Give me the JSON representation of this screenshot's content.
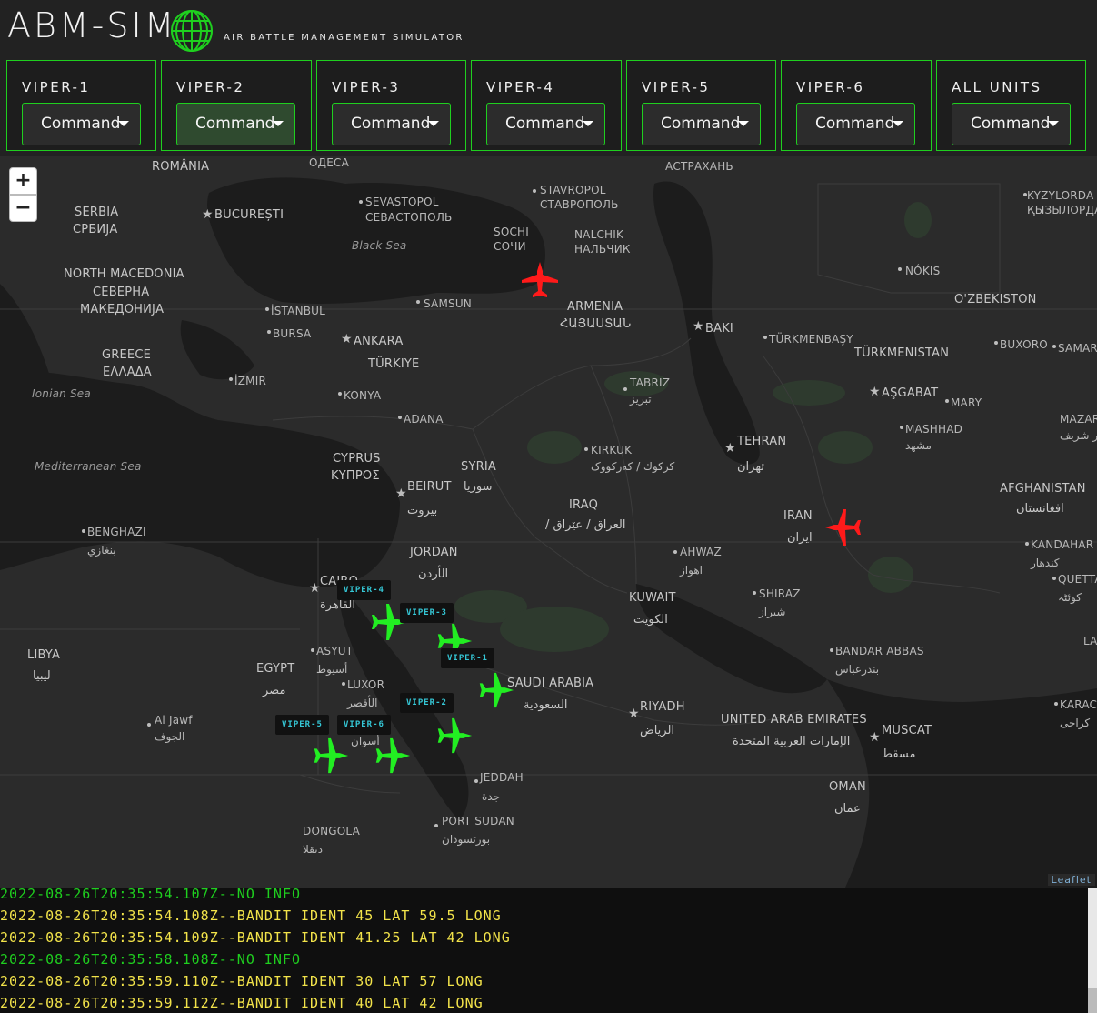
{
  "header": {
    "title": "ABM-SIM",
    "subtitle": "AIR BATTLE MANAGEMENT SIMULATOR"
  },
  "units": [
    {
      "name": "VIPER-1",
      "command_label": "Command"
    },
    {
      "name": "VIPER-2",
      "command_label": "Command"
    },
    {
      "name": "VIPER-3",
      "command_label": "Command"
    },
    {
      "name": "VIPER-4",
      "command_label": "Command"
    },
    {
      "name": "VIPER-5",
      "command_label": "Command"
    },
    {
      "name": "VIPER-6",
      "command_label": "Command"
    },
    {
      "name": "ALL UNITS",
      "command_label": "Command"
    }
  ],
  "map": {
    "zoom_in": "+",
    "zoom_out": "−",
    "attribution": "Leaflet",
    "labels": {
      "romania": "ROMÂNIA",
      "odesa": "ОДЕСА",
      "astrakhan": "АСТРАХАНЬ",
      "kyzylorda": "KYZYLORDA",
      "kyzylorda_local": "ҚЫЗЫЛОРДА",
      "serbia": "SERBIA",
      "serbia_local": "СРБИЈА",
      "bucuresti": "BUCUREȘTI",
      "sevastopol": "SEVASTOPOL",
      "sevastopol_local": "СЕВАСТОПОЛЬ",
      "stavropol": "STAVROPOL",
      "stavropol_local": "СТАВРОПОЛЬ",
      "sochi": "SOCHI",
      "sochi_local": "СОЧИ",
      "nalchik": "NALCHIK",
      "nalchik_local": "НАЛЬЧИК",
      "black_sea": "Black Sea",
      "nokis": "NÓKIS",
      "n_macedonia": "NORTH MACEDONIA",
      "n_macedonia_l1": "СЕВЕРНА",
      "n_macedonia_l2": "МАКЕДОНИЈА",
      "samsun": "SAMSUN",
      "armenia": "ARMENIA",
      "armenia_local": "ՀԱՅԱՍՏԱՆ",
      "uzbekistan": "O'ZBEKISTON",
      "istanbul": "İSTANBUL",
      "baki": "BAKI",
      "bursa": "BURSA",
      "ankara": "ANKARA",
      "turkmenbasy": "TÜRKMENBAŞY",
      "buxoro": "BUXORO",
      "samarqand": "SAMARQ",
      "greece": "GREECE",
      "greece_local": "ΕΛΛΑΔΑ",
      "turkiye": "TÜRKIYE",
      "turkmenistan": "TÜRKMENISTAN",
      "izmir": "İZMIR",
      "tabriz": "TABRIZ",
      "tabriz_local": "تبریز",
      "ionian": "Ionian Sea",
      "konya": "KONYA",
      "asgabat": "AŞGABAT",
      "mary": "MARY",
      "adana": "ADANA",
      "mashhad": "MASHHAD",
      "mashhad_local": "مشهد",
      "mazar": "MAZAR",
      "mazar_local": "مزار شریف",
      "kirkuk": "KIRKUK",
      "kirkuk_local": "كركوك / کەرکووک",
      "tehran": "TEHRAN",
      "tehran_local": "تهران",
      "cyprus": "CYPRUS",
      "cyprus_local": "ΚΥΠΡΟΣ",
      "syria": "SYRIA",
      "syria_local": "سوريا",
      "med_sea": "Mediterranean Sea",
      "afghanistan": "AFGHANISTAN",
      "afghanistan_local": "افغانستان",
      "beirut": "BEIRUT",
      "beirut_local": "بيروت",
      "iraq": "IRAQ",
      "iraq_local": "/ العراق / عێراق",
      "iran": "IRAN",
      "iran_local": "ایران",
      "benghazi": "BENGHAZI",
      "benghazi_local": "بنغازي",
      "jordan": "JORDAN",
      "jordan_local": "الأردن",
      "ahwaz": "AHWAZ",
      "ahwaz_local": "اهواز",
      "kandahar": "KANDAHAR",
      "kandahar_local": "کندهار",
      "cairo": "CAIRO",
      "cairo_local": "القاهرة",
      "quetta": "QUETTA",
      "quetta_local": "کوئٹہ",
      "kuwait": "KUWAIT",
      "kuwait_local": "الكويت",
      "shiraz": "SHIRAZ",
      "shiraz_local": "شيراز",
      "libya": "LIBYA",
      "libya_local": "ليبيا",
      "asyut": "ASYUT",
      "asyut_local": "أسيوط",
      "bandar_abbas": "BANDAR ABBAS",
      "bandar_abbas_local": "بندرعباس",
      "lah": "LAH",
      "egypt": "EGYPT",
      "egypt_local": "مصر",
      "luxor": "LUXOR",
      "luxor_local": "الأقصر",
      "saudi": "SAUDI ARABIA",
      "saudi_local": "السعودية",
      "karachi": "KARACH",
      "karachi_local": "کراچی",
      "riyadh": "RIYADH",
      "riyadh_local": "الرياض",
      "aljawf": "Al Jawf",
      "aljawf_local": "الجوف",
      "uae": "UNITED ARAB EMIRATES",
      "uae_local": "الإمارات العربية المتحدة",
      "muscat": "MUSCAT",
      "muscat_local": "مسقط",
      "aswan_local": "أسوان",
      "jeddah": "JEDDAH",
      "jeddah_local": "جدة",
      "oman": "OMAN",
      "oman_local": "عمان",
      "port_sudan": "PORT SUDAN",
      "port_sudan_local": "بورتسودان",
      "dongola": "DONGOLA",
      "dongola_local": "دنقلا"
    },
    "callsigns": [
      "VIPER-4",
      "VIPER-3",
      "VIPER-1",
      "VIPER-2",
      "VIPER-5",
      "VIPER-6"
    ],
    "friendly_color": "#22ee22",
    "bandit_color": "#ff1a1a",
    "callsign_color": "#35c7d6"
  },
  "log": [
    {
      "text": "2022-08-26T20:35:54.107Z--NO INFO",
      "kind": "info"
    },
    {
      "text": "2022-08-26T20:35:54.108Z--BANDIT IDENT 45 LAT 59.5 LONG",
      "kind": "bandit"
    },
    {
      "text": "2022-08-26T20:35:54.109Z--BANDIT IDENT 41.25 LAT 42 LONG",
      "kind": "bandit"
    },
    {
      "text": "2022-08-26T20:35:58.108Z--NO INFO",
      "kind": "info"
    },
    {
      "text": "2022-08-26T20:35:59.110Z--BANDIT IDENT 30 LAT 57 LONG",
      "kind": "bandit"
    },
    {
      "text": "2022-08-26T20:35:59.112Z--BANDIT IDENT 40 LAT 42 LONG",
      "kind": "bandit"
    }
  ]
}
